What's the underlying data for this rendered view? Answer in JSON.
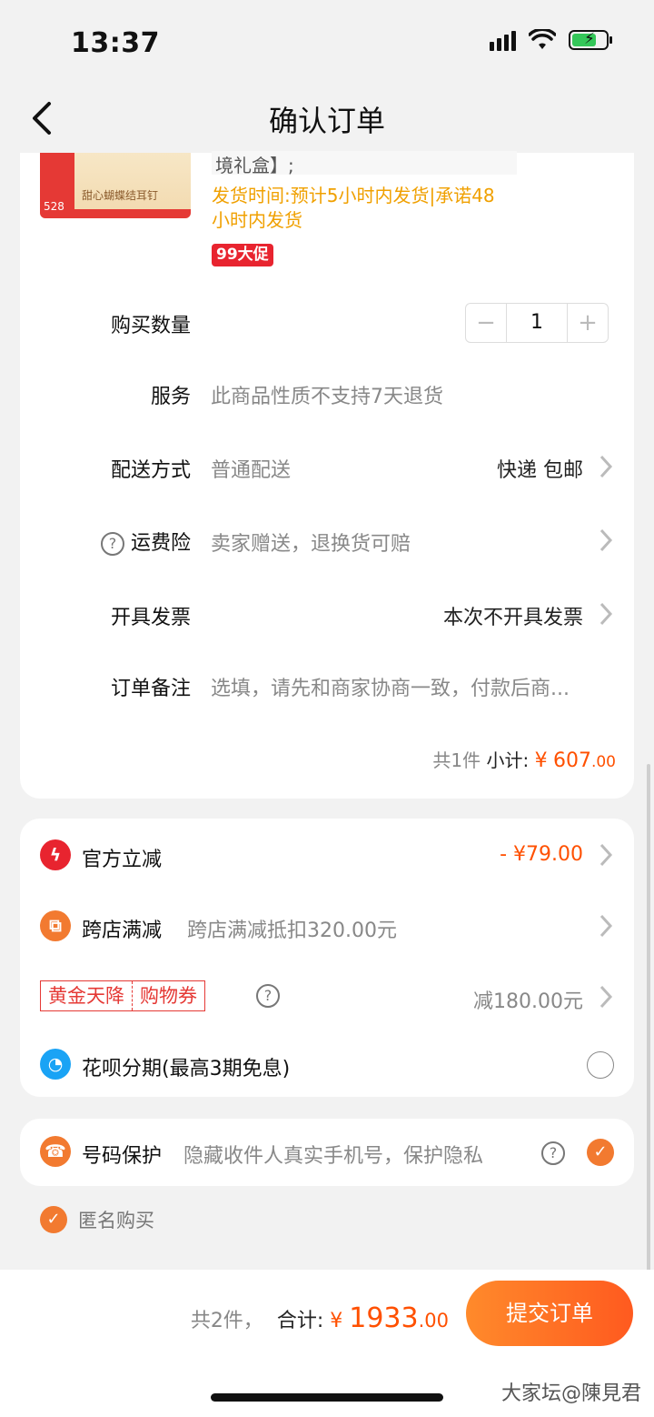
{
  "status_bar": {
    "time": "13:37"
  },
  "nav": {
    "title": "确认订单"
  },
  "product": {
    "name_tail": "境礼盒】;",
    "image_text": "甜心蝴蝶结耳钉",
    "badge_price": "528",
    "ship_time": "发货时间:预计5小时内发货|承诺48小时内发货",
    "promo_tag": "99大促"
  },
  "order": {
    "quantity_label": "购买数量",
    "quantity": "1",
    "service_label": "服务",
    "service_value": "此商品性质不支持7天退货",
    "delivery_label": "配送方式",
    "delivery_value": "普通配送",
    "delivery_right": "快递 包邮",
    "insurance_label": "运费险",
    "insurance_value": "卖家赠送，退换货可赔",
    "invoice_label": "开具发票",
    "invoice_right": "本次不开具发票",
    "note_label": "订单备注",
    "note_placeholder": "选填，请先和商家协商一致，付款后商...",
    "subtotal_count": "共1件",
    "subtotal_label": "小计:",
    "subtotal_currency": "¥",
    "subtotal_int": "607",
    "subtotal_dec": ".00"
  },
  "discounts": {
    "official_label": "官方立减",
    "official_value": "- ¥79.00",
    "cross_label": "跨店满减",
    "cross_desc": "跨店满减抵扣320.00元",
    "gold_left": "黄金天降",
    "gold_right": "购物券",
    "gold_value": "减180.00元",
    "huabei_label": "花呗分期(最高3期免息)"
  },
  "protection": {
    "label": "号码保护",
    "desc": "隐藏收件人真实手机号，保护隐私"
  },
  "anonymous": {
    "label": "匿名购买"
  },
  "footer": {
    "count": "共2件，",
    "total_label": "合计:",
    "currency": "¥",
    "total_int": "1933",
    "total_dec": ".00",
    "submit": "提交订单"
  },
  "watermark": "大家坛@陳見君",
  "colors": {
    "accent": "#ff5000",
    "ship_text": "#f0a000",
    "promo_red": "#e8242f",
    "check_orange": "#f27a30"
  }
}
